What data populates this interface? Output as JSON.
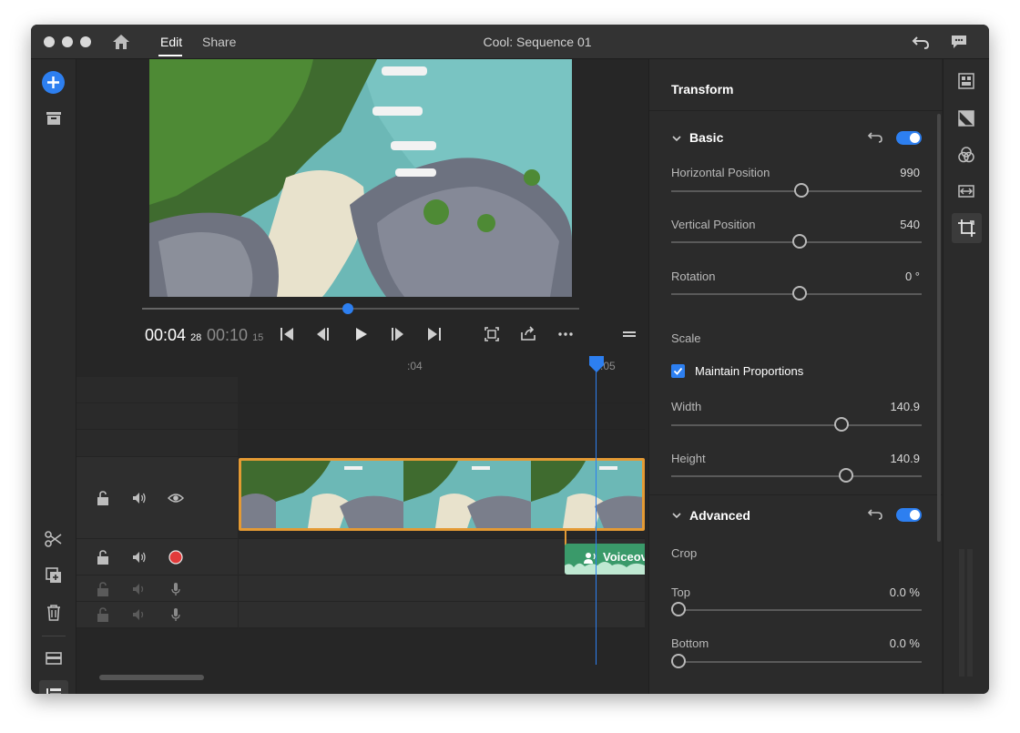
{
  "app": {
    "title": "Cool: Sequence 01",
    "tabs": [
      "Edit",
      "Share"
    ],
    "active_tab": "Edit"
  },
  "player": {
    "current_time": "00:04",
    "current_frames": "28",
    "duration_time": "00:10",
    "duration_frames": "15",
    "scrub_fraction": 0.47
  },
  "timeline": {
    "ruler_labels": [
      ":04",
      ":05"
    ],
    "voice_clip_label": "Voiceov"
  },
  "panel": {
    "title": "Transform",
    "basic": {
      "title": "Basic",
      "enabled": true,
      "properties": [
        {
          "label": "Horizontal Position",
          "value": "990",
          "fraction": 0.52
        },
        {
          "label": "Vertical Position",
          "value": "540",
          "fraction": 0.515
        },
        {
          "label": "Rotation",
          "value": "0 °",
          "fraction": 0.515
        }
      ],
      "scale_label": "Scale",
      "maintain_proportions_label": "Maintain Proportions",
      "maintain_proportions": true,
      "scale": [
        {
          "label": "Width",
          "value": "140.9",
          "fraction": 0.69
        },
        {
          "label": "Height",
          "value": "140.9",
          "fraction": 0.71
        }
      ]
    },
    "advanced": {
      "title": "Advanced",
      "enabled": true,
      "crop_label": "Crop",
      "crop": [
        {
          "label": "Top",
          "value": "0.0 %",
          "fraction": 0.0
        },
        {
          "label": "Bottom",
          "value": "0.0 %",
          "fraction": 0.0
        }
      ]
    }
  },
  "colors": {
    "accent": "#2d7ff0",
    "clip_border": "#e49a34",
    "record": "#e23b3b",
    "voice_clip": "#3a9a6a"
  }
}
